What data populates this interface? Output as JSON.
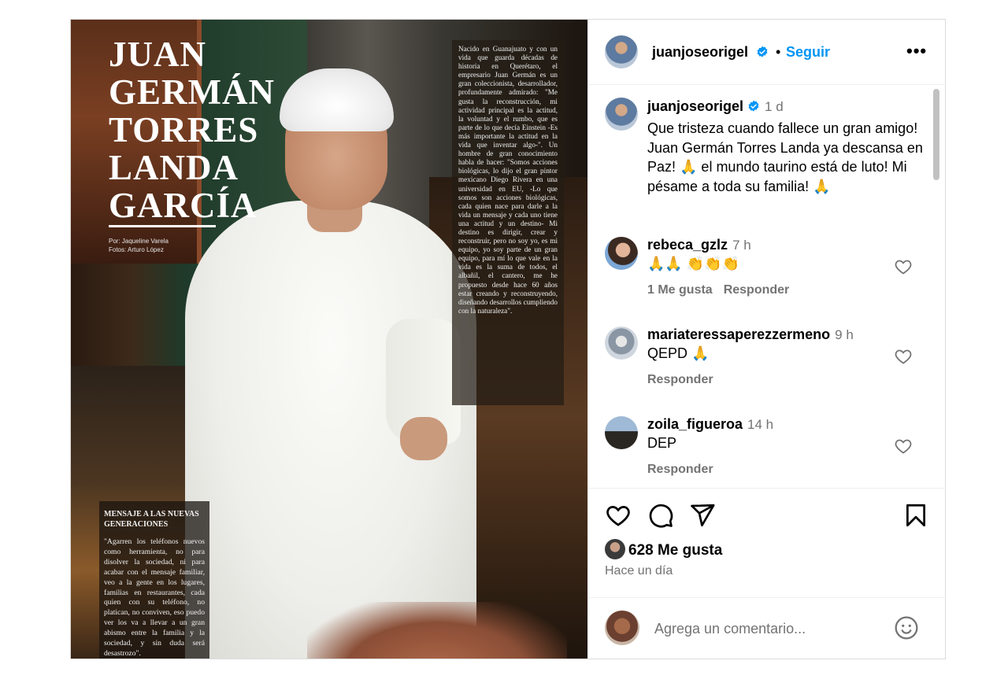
{
  "magazine": {
    "title": "JUAN GERMÁN TORRES LANDA GARCÍA",
    "credit_author": "Por: Jaqueline Varela",
    "credit_photos": "Fotos: Arturo López",
    "article_text": "Nacido en Guanajuato y con un vida que guarda décadas de historia en Querétaro, el empresario Juan Germán es un gran coleccionista, desarrollador, profundamente admirado: \"Me gusta la reconstrucción, mi actividad principal es la actitud, la voluntad y el rumbo, que es parte de lo que decía Einstein -Es más importante la actitud en la vida que inventar algo-\". Un hombre de gran conocimiento habla de hacer: \"Somos acciones biológicas, lo dijo el gran pintor mexicano Diego Rivera en una universidad en EU, -Lo que somos son acciones biológicas, cada quien nace para darle a la vida un mensaje y cada uno tiene una actitud y un destino- Mi destino es dirigir, crear y reconstruir, pero no soy yo, es mi equipo, yo soy parte de un gran equipo, para mí lo que vale en la vida es la suma de todos, el albañil, el cantero, me he propuesto desde hace 60 años estar creando y reconstruyendo, diseñando desarrollos cumpliendo con la naturaleza\".",
    "message_heading": "MENSAJE A LAS NUEVAS GENERACIONES",
    "message_text": "\"Agarren los teléfonos nuevos como herramienta, no para disolver la sociedad, ni para acabar con el mensaje familiar, veo a la gente en los lugares, familias en restaurantes, cada quien con su teléfono, no platican, no conviven, eso puedo ver los va a llevar a un gran abismo entre la familia y la sociedad, y sin duda será desastrozo\"."
  },
  "header": {
    "username": "juanjoseorigel",
    "separator": "•",
    "follow_label": "Seguir",
    "more_label": "•••"
  },
  "caption": {
    "username": "juanjoseorigel",
    "time": "1 d",
    "text": "Que tristeza cuando fallece un gran amigo! Juan Germán Torres Landa ya descansa en Paz! 🙏 el mundo taurino está de luto! Mi pésame a toda su familia! 🙏"
  },
  "comments": [
    {
      "username": "rebeca_gzlz",
      "time": "7 h",
      "text": "🙏🙏 👏👏👏",
      "likes_label": "1 Me gusta",
      "reply_label": "Responder"
    },
    {
      "username": "mariateressaperezzermeno",
      "time": "9 h",
      "text": "QEPD 🙏",
      "likes_label": "",
      "reply_label": "Responder"
    },
    {
      "username": "zoila_figueroa",
      "time": "14 h",
      "text": "DEP",
      "likes_label": "",
      "reply_label": "Responder"
    }
  ],
  "footer": {
    "likes_count": "628 Me gusta",
    "date_label": "Hace un día",
    "comment_placeholder": "Agrega un comentario..."
  },
  "colors": {
    "accent": "#0095f6",
    "muted": "#737373",
    "border": "#dbdbdb"
  },
  "icons": [
    "verified-badge-icon",
    "heart-icon",
    "comment-icon",
    "share-icon",
    "bookmark-icon",
    "emoji-icon",
    "more-icon"
  ]
}
